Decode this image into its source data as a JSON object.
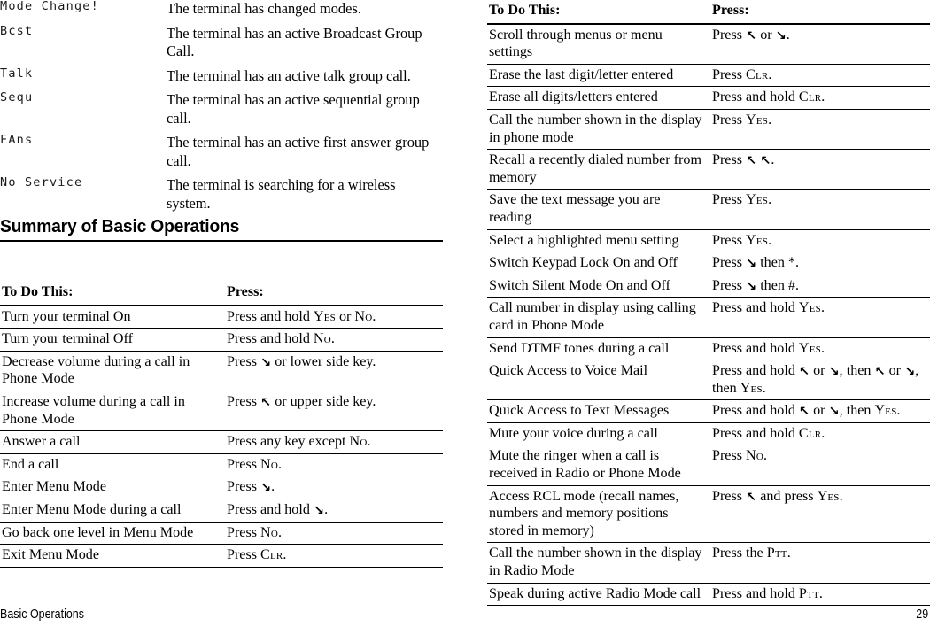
{
  "document": {
    "footer": {
      "section_label": "Basic Operations",
      "page_number": "29"
    }
  },
  "display_legend": {
    "rows": [
      {
        "indicator": "Mode Change!",
        "description": "The terminal has changed modes."
      },
      {
        "indicator": "Bcst",
        "description": "The terminal has an active Broadcast Group Call."
      },
      {
        "indicator": "Talk",
        "description": "The terminal has an active talk group call."
      },
      {
        "indicator": "Sequ",
        "description": "The terminal has an active sequential group call."
      },
      {
        "indicator": "FAns",
        "description": "The terminal has an active first answer group call."
      },
      {
        "indicator": "No Service",
        "description": "The terminal is searching for a wireless system."
      }
    ]
  },
  "section": {
    "heading": "Summary of Basic Operations"
  },
  "ops_table_left": {
    "headers": {
      "col1": "To Do This:",
      "col2": "Press:"
    },
    "rows": [
      {
        "action": "Turn your terminal On",
        "press": "Press and hold YES or NO."
      },
      {
        "action": "Turn your terminal Off",
        "press": "Press and hold NO."
      },
      {
        "action": "Decrease volume during a call in Phone Mode",
        "press": "Press ↘ or lower side key."
      },
      {
        "action": "Increase volume during a call in Phone Mode",
        "press": "Press ↖ or upper side key."
      },
      {
        "action": "Answer a call",
        "press": "Press any key except NO."
      },
      {
        "action": "End a call",
        "press": "Press NO."
      },
      {
        "action": "Enter Menu Mode",
        "press": "Press ↘."
      },
      {
        "action": "Enter Menu Mode during a call",
        "press": "Press and hold ↘."
      },
      {
        "action": "Go back one level in Menu Mode",
        "press": "Press NO."
      },
      {
        "action": "Exit Menu Mode",
        "press": "Press CLR."
      }
    ]
  },
  "ops_table_right": {
    "headers": {
      "col1": "To Do This:",
      "col2": "Press:"
    },
    "rows": [
      {
        "action": "Scroll through menus or menu settings",
        "press": "Press ↖ or ↘."
      },
      {
        "action": "Erase the last digit/letter entered",
        "press": "Press CLR."
      },
      {
        "action": "Erase all digits/letters entered",
        "press": "Press and hold CLR."
      },
      {
        "action": "Call the number shown in the display in phone mode",
        "press": "Press YES."
      },
      {
        "action": "Recall a recently dialed number from memory",
        "press": "Press ↖ ↖."
      },
      {
        "action": "Save the text message you are reading",
        "press": "Press YES."
      },
      {
        "action": "Select a highlighted menu setting",
        "press": "Press YES."
      },
      {
        "action": "Switch Keypad Lock On and Off",
        "press": "Press ↘ then *."
      },
      {
        "action": "Switch Silent Mode On and Off",
        "press": "Press ↘ then #."
      },
      {
        "action": "Call number in display using calling card in Phone Mode",
        "press": "Press and hold YES."
      },
      {
        "action": "Send DTMF tones during a call",
        "press": "Press and hold YES."
      },
      {
        "action": "Quick Access to Voice Mail",
        "press": "Press and hold ↖ or ↘, then ↖ or ↘, then YES."
      },
      {
        "action": "Quick Access to Text Messages",
        "press": "Press and hold ↖ or ↘, then YES."
      },
      {
        "action": "Mute your voice during a call",
        "press": "Press and hold CLR."
      },
      {
        "action": "Mute the ringer when a call is received in Radio or Phone Mode",
        "press": "Press NO."
      },
      {
        "action": "Access RCL mode (recall names, numbers and memory positions stored in memory)",
        "press": "Press ↖ and press YES."
      },
      {
        "action": "Call the number shown in the display in Radio Mode",
        "press": "Press the PTT."
      },
      {
        "action": "Speak during active Radio Mode call",
        "press": "Press and hold PTT."
      }
    ]
  },
  "key_names": [
    "YES",
    "NO",
    "CLR",
    "PTT"
  ],
  "icons": {
    "arrow_down_right": "↘",
    "arrow_up_left": "↖"
  },
  "colors": {
    "text": "#000000",
    "rule": "#000000",
    "background": "#ffffff"
  }
}
